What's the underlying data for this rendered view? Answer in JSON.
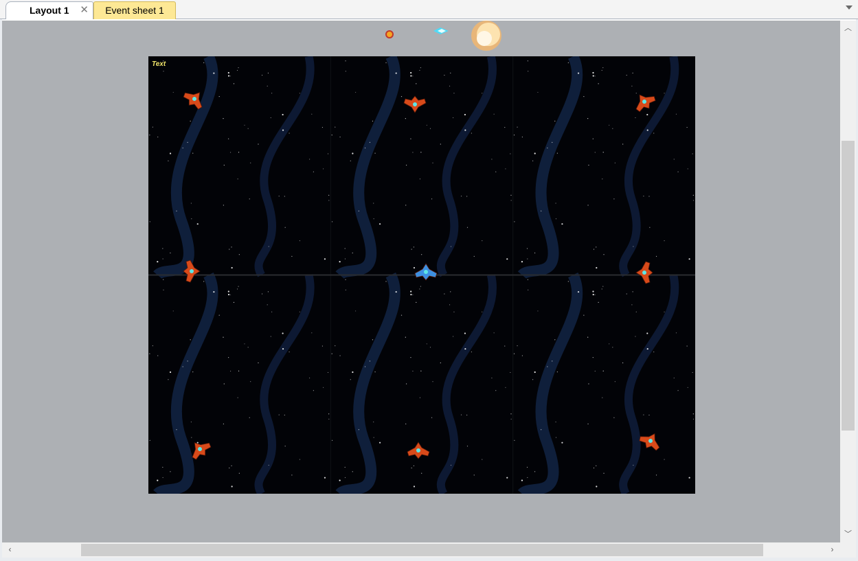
{
  "tabs": [
    {
      "label": "Layout 1",
      "active": true,
      "close_glyph": "✕"
    },
    {
      "label": "Event sheet 1",
      "active": false
    }
  ],
  "tab_menu_icon": "chevron-down-icon",
  "layout": {
    "text_object": "Text",
    "background": "#020307",
    "view_background": "#adb0b4",
    "tile_columns": 3,
    "tile_rows": 2,
    "enemy_color": "#d84a1a",
    "player_color": "#3d8fe0"
  },
  "scrollbars": {
    "vertical": {
      "up_icon": "arrow-up-icon",
      "down_icon": "arrow-down-icon"
    },
    "horizontal": {
      "left_icon": "arrow-left-icon",
      "right_icon": "arrow-right-icon"
    }
  }
}
